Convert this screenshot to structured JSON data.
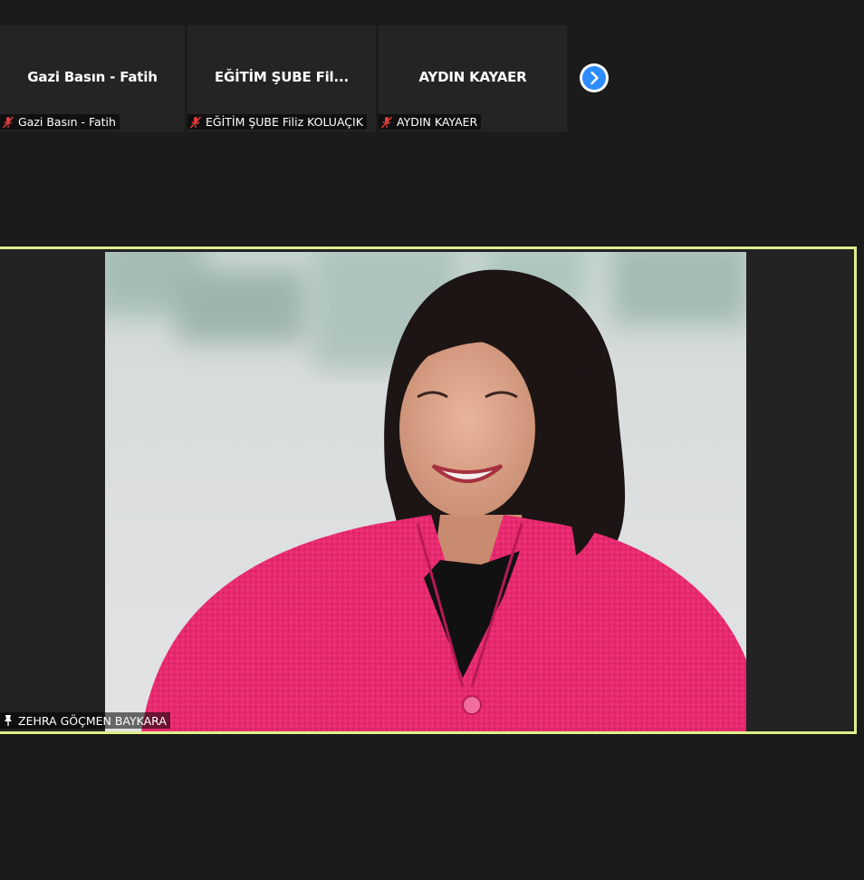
{
  "thumbnails": [
    {
      "title": "Gazi Basın - Fatih",
      "label": "Gazi Basın - Fatih",
      "mic_icon": "mic-muted-icon"
    },
    {
      "title": "EĞİTİM ŞUBE Fil...",
      "label": "EĞİTİM ŞUBE Filiz KOLUAÇIK",
      "mic_icon": "mic-muted-icon"
    },
    {
      "title": "AYDIN KAYAER",
      "label": "AYDIN KAYAER",
      "mic_icon": "mic-muted-icon"
    }
  ],
  "next_page_icon": "chevron-right-icon",
  "active_speaker": {
    "name": "ZEHRA GÖÇMEN BAYKARA",
    "icon": "pin-icon",
    "highlight_color": "#ddef8a"
  },
  "colors": {
    "background": "#1b1b1b",
    "tile": "#242424",
    "accent": "#2d8cff",
    "mute": "#e03c3c",
    "jacket": "#e8296f"
  }
}
